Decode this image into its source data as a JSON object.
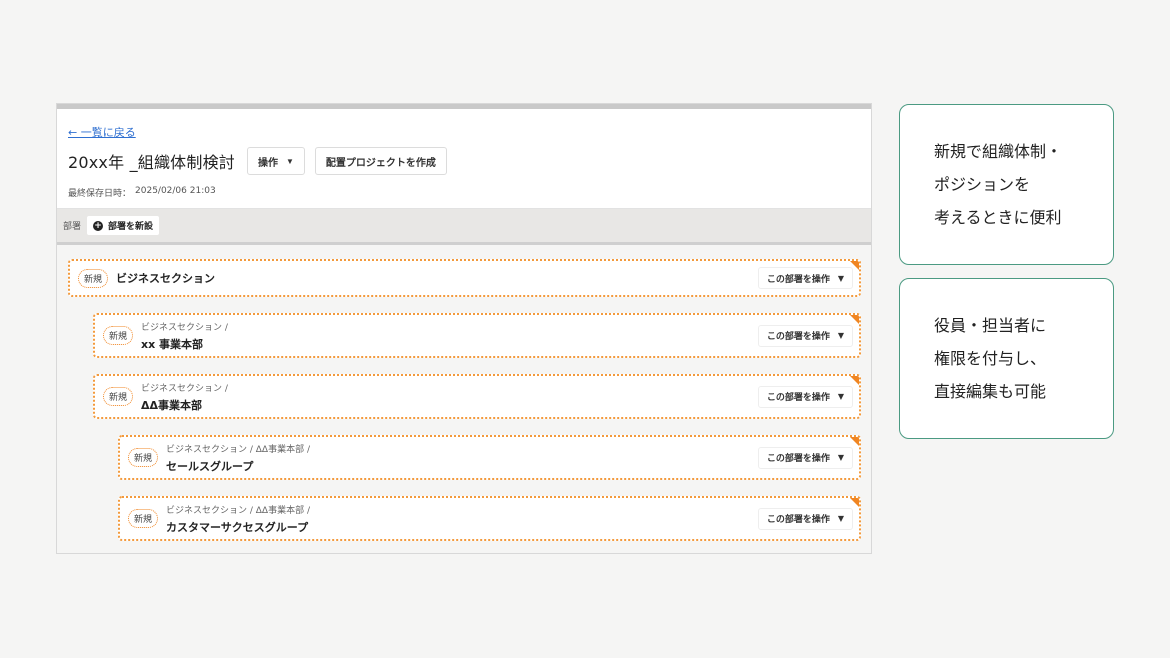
{
  "header": {
    "back_link": "← 一覧に戻る",
    "title": "20xx年 _組織体制検討",
    "operation_label": "操作",
    "create_project_label": "配置プロジェクトを作成",
    "saved_label": "最終保存日時：",
    "saved_value": "2025/02/06 21:03"
  },
  "deptbar": {
    "label": "部署",
    "add_label": "部署を新設"
  },
  "departments": [
    {
      "badge": "新規",
      "breadcrumb": "",
      "name": "ビジネスセクション",
      "action": "この部署を操作"
    },
    {
      "badge": "新規",
      "breadcrumb": "ビジネスセクション /",
      "name": "xx 事業本部",
      "action": "この部署を操作"
    },
    {
      "badge": "新規",
      "breadcrumb": "ビジネスセクション /",
      "name": "ΔΔ事業本部",
      "action": "この部署を操作"
    },
    {
      "badge": "新規",
      "breadcrumb": "ビジネスセクション / ΔΔ事業本部 /",
      "name": "セールスグループ",
      "action": "この部署を操作"
    },
    {
      "badge": "新規",
      "breadcrumb": "ビジネスセクション / ΔΔ事業本部 /",
      "name": "カスタマーサクセスグループ",
      "action": "この部署を操作"
    }
  ],
  "features": [
    {
      "lines": [
        "新規で組織体制・",
        "ポジションを",
        "考えるときに便利"
      ]
    },
    {
      "lines": [
        "役員・担当者に",
        "権限を付与し、",
        "直接編集も可能"
      ]
    }
  ],
  "colors": {
    "accent_orange": "#f08522",
    "link_blue": "#2f6fd0",
    "feature_border": "#4b9a82"
  }
}
